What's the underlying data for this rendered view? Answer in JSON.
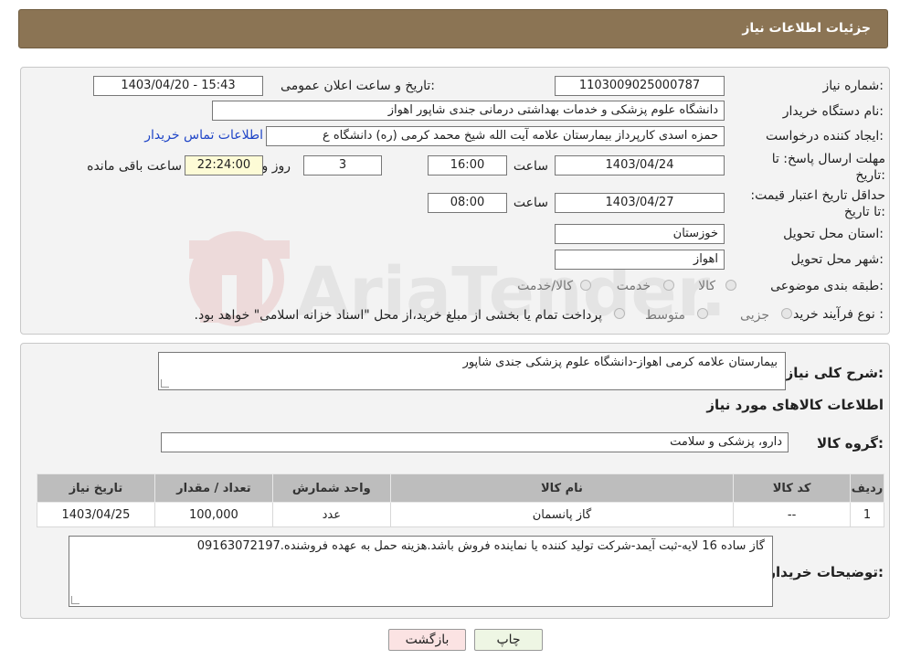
{
  "header": {
    "title": "جزئیات اطلاعات نیاز"
  },
  "fields": {
    "need_number_label": "شماره نیاز:",
    "need_number": "1103009025000787",
    "announce_label": "تاریخ و ساعت اعلان عمومی:",
    "announce_value": "1403/04/20 - 15:43",
    "buyer_org_label": "نام دستگاه خریدار:",
    "buyer_org": "دانشگاه علوم پزشکی و خدمات بهداشتی درمانی جندی شاپور اهواز",
    "creator_label": "ایجاد کننده درخواست:",
    "creator": "حمزه اسدی کارپرداز بیمارستان علامه آیت الله شیخ محمد کرمی (ره) دانشگاه ع",
    "contact_link": "اطلاعات تماس خریدار",
    "deadline_label": "مهلت ارسال پاسخ: تا تاریخ:",
    "deadline_date": "1403/04/24",
    "time_label": "ساعت",
    "deadline_time": "16:00",
    "days_value": "3",
    "days_label": "روز و",
    "remaining_time": "22:24:00",
    "remaining_label": "ساعت باقی مانده",
    "validity_label": "حداقل تاریخ اعتبار قیمت: تا تاریخ:",
    "validity_date": "1403/04/27",
    "validity_time": "08:00",
    "province_label": "استان محل تحویل:",
    "province": "خوزستان",
    "city_label": "شهر محل تحویل:",
    "city": "اهواز",
    "category_label": "طبقه بندی موضوعی:",
    "category_options": [
      "کالا",
      "خدمت",
      "کالا/خدمت"
    ],
    "process_label": "نوع فرآیند خرید :",
    "process_options": [
      "جزیی",
      "متوسط"
    ],
    "process_note": "پرداخت تمام یا بخشی از مبلغ خرید،از محل \"اسناد خزانه اسلامی\" خواهد بود."
  },
  "summary": {
    "desc_label": "شرح کلی نیاز:",
    "desc_value": "بیمارستان علامه کرمی اهواز-دانشگاه علوم پزشکی جندی شاپور",
    "goods_info_title": "اطلاعات کالاهای مورد نیاز",
    "group_label": "گروه کالا:",
    "group_value": "دارو، پزشکی و سلامت"
  },
  "table": {
    "headers": [
      "ردیف",
      "کد کالا",
      "نام کالا",
      "واحد شمارش",
      "تعداد / مقدار",
      "تاریخ نیاز"
    ],
    "rows": [
      [
        "1",
        "--",
        "گاز پانسمان",
        "عدد",
        "100,000",
        "1403/04/25"
      ]
    ]
  },
  "buyer_notes": {
    "label": "توضیحات خریدار:",
    "value": "گاز ساده 16 لایه-ثبت آیمد-شرکت تولید کننده یا نماینده فروش باشد.هزینه حمل به عهده فروشنده.09163072197"
  },
  "buttons": {
    "print": "چاپ",
    "back": "بازگشت"
  },
  "watermark": {
    "text": "AriaTender.neT"
  },
  "colors": {
    "header": "#8b7454",
    "link": "#1f45c7",
    "back_button": "#fbe3e3",
    "print_button": "#eef6e4",
    "yellow": "#fdfbd6"
  }
}
